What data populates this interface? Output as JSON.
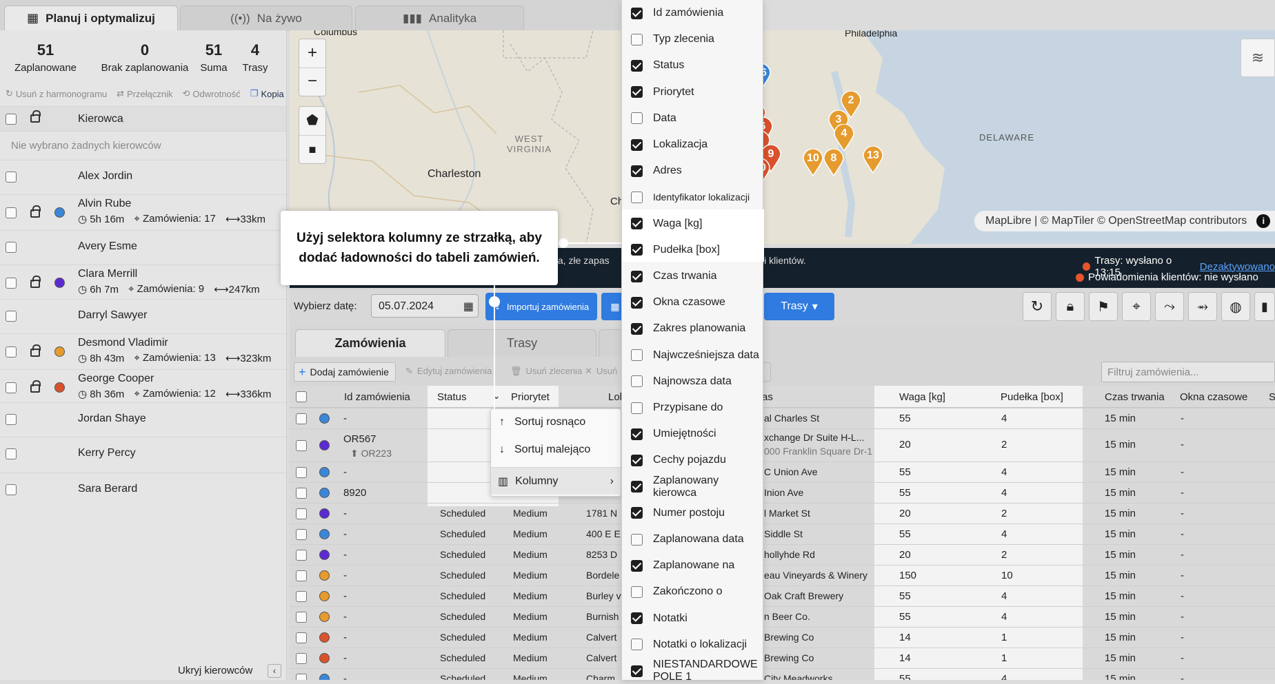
{
  "tabs": [
    {
      "label": "Planuj i optymalizuj",
      "icon": "calendar-icon"
    },
    {
      "label": "Na żywo",
      "icon": "broadcast-icon"
    },
    {
      "label": "Analityka",
      "icon": "bar-chart-icon"
    }
  ],
  "stats": [
    {
      "value": "51",
      "label": "Zaplanowane"
    },
    {
      "value": "0",
      "label": "Brak zaplanowania"
    },
    {
      "value": "51",
      "label": "Suma"
    },
    {
      "value": "4",
      "label": "Trasy"
    }
  ],
  "actions": {
    "remove": "Usuń z harmonogramu",
    "switch": "Przełącznik",
    "reverse": "Odwrotność",
    "copy": "Kopia"
  },
  "drivers_header": "Kierowca",
  "no_drivers": "Nie wybrano żadnych kierowców",
  "drivers": [
    {
      "name": "Alex Jordin"
    },
    {
      "name": "Alvin Rube",
      "color": "#3a86d8",
      "time": "5h 16m",
      "orders": "Zamówienia: 17",
      "dist": "33km"
    },
    {
      "name": "Avery Esme"
    },
    {
      "name": "Clara Merrill",
      "color": "#5b2bd1",
      "time": "6h 7m",
      "orders": "Zamówienia: 9",
      "dist": "247km"
    },
    {
      "name": "Darryl Sawyer"
    },
    {
      "name": "Desmond Vladimir",
      "color": "#e69b2e",
      "time": "8h 43m",
      "orders": "Zamówienia: 13",
      "dist": "323km"
    },
    {
      "name": "George Cooper",
      "color": "#d9522c",
      "time": "8h 36m",
      "orders": "Zamówienia: 12",
      "dist": "336km"
    },
    {
      "name": "Jordan Shaye"
    },
    {
      "name": "Kerry Percy"
    },
    {
      "name": "Sara Berard"
    }
  ],
  "hide_drivers": "Ukryj kierowców",
  "map": {
    "labels": [
      "Columbus",
      "Philadelphia",
      "WEST\nVIRGINIA",
      "Charleston",
      "DELAWARE",
      "Ch"
    ],
    "attribution": "MapLibre | © MapTiler © OpenStreetMap contributors",
    "pins": [
      "16",
      "2",
      "4",
      "3",
      "6",
      "7",
      "9",
      "10",
      "4",
      "10",
      "8",
      "13"
    ]
  },
  "banner": {
    "mid": "dla, złe zapas",
    "right_mid": "ji klientów.",
    "routes": "Trasy: wysłano o 13:15",
    "deactivate": "Dezaktywowano",
    "notif": "Powiadomienia klientów: nie wysłano"
  },
  "toolbar": {
    "date_label": "Wybierz datę:",
    "date": "05.07.2024",
    "import": "Importuj zamówienia",
    "routes": "Trasy"
  },
  "order_tabs": [
    "Zamówienia",
    "Trasy"
  ],
  "table_actions": {
    "add": "Dodaj zamówienie",
    "edit": "Edytuj zamówienia",
    "del": "Usuń zlecenia",
    "cancel": "Usuń"
  },
  "filter_placeholder": "Filtruj zamówienia...",
  "columns": {
    "id": "Id zamówienia",
    "status": "Status",
    "priority": "Priorytet",
    "location": "Lokaliza",
    "address": "as",
    "weight": "Waga [kg]",
    "boxes": "Pudełka [box]",
    "duration": "Czas trwania",
    "windows": "Okna czasowe",
    "extra": "S"
  },
  "rows": [
    {
      "color": "#3a86d8",
      "id": "-",
      "status": "",
      "priority": "",
      "loc": "",
      "addr": "al Charles St",
      "w": "55",
      "b": "4",
      "d": "15 min",
      "win": "-"
    },
    {
      "color": "#5b2bd1",
      "id": "OR567",
      "sub": "OR223",
      "status": "",
      "priority": "",
      "loc": "",
      "addr": "xchange Dr Suite H-L...",
      "addr2": "000 Franklin Square Dr-1...",
      "w": "20",
      "b": "2",
      "d": "15 min",
      "win": "-"
    },
    {
      "color": "#3a86d8",
      "id": "-",
      "status": "",
      "priority": "",
      "loc": "",
      "addr": "C Union Ave",
      "w": "55",
      "b": "4",
      "d": "15 min",
      "win": "-"
    },
    {
      "color": "#3a86d8",
      "id": "8920",
      "status": "",
      "priority": "",
      "loc": "",
      "addr": "Inion Ave",
      "w": "55",
      "b": "4",
      "d": "15 min",
      "win": "-"
    },
    {
      "color": "#5b2bd1",
      "id": "-",
      "status": "Scheduled",
      "priority": "Medium",
      "loc": "1781 N",
      "addr": "l Market St",
      "w": "20",
      "b": "2",
      "d": "15 min",
      "win": "-"
    },
    {
      "color": "#3a86d8",
      "id": "-",
      "status": "Scheduled",
      "priority": "Medium",
      "loc": "400 E E",
      "addr": "Siddle St",
      "w": "55",
      "b": "4",
      "d": "15 min",
      "win": "-"
    },
    {
      "color": "#5b2bd1",
      "id": "-",
      "status": "Scheduled",
      "priority": "Medium",
      "loc": "8253 D",
      "addr": "hollyhde Rd",
      "w": "20",
      "b": "2",
      "d": "15 min",
      "win": "-"
    },
    {
      "color": "#e69b2e",
      "id": "-",
      "status": "Scheduled",
      "priority": "Medium",
      "loc": "Bordele",
      "addr": "eau Vineyards & Winery",
      "w": "150",
      "b": "10",
      "d": "15 min",
      "win": "-"
    },
    {
      "color": "#e69b2e",
      "id": "-",
      "status": "Scheduled",
      "priority": "Medium",
      "loc": "Burley v",
      "addr": "Oak Craft Brewery",
      "w": "55",
      "b": "4",
      "d": "15 min",
      "win": "-"
    },
    {
      "color": "#e69b2e",
      "id": "-",
      "status": "Scheduled",
      "priority": "Medium",
      "loc": "Burnish",
      "addr": "n Beer Co.",
      "w": "55",
      "b": "4",
      "d": "15 min",
      "win": "-"
    },
    {
      "color": "#d9522c",
      "id": "-",
      "status": "Scheduled",
      "priority": "Medium",
      "loc": "Calvert",
      "addr": "Brewing Co",
      "w": "14",
      "b": "1",
      "d": "15 min",
      "win": "-"
    },
    {
      "color": "#d9522c",
      "id": "-",
      "status": "Scheduled",
      "priority": "Medium",
      "loc": "Calvert",
      "addr": "Brewing Co",
      "w": "14",
      "b": "1",
      "d": "15 min",
      "win": "-"
    },
    {
      "color": "#3a86d8",
      "id": "-",
      "status": "Scheduled",
      "priority": "Medium",
      "loc": "Charm",
      "addr": "City Meadworks",
      "w": "55",
      "b": "4",
      "d": "15 min",
      "win": "-"
    }
  ],
  "context_menu": {
    "asc": "Sortuj rosnąco",
    "desc": "Sortuj malejąco",
    "cols": "Kolumny"
  },
  "tooltip": "Użyj selektora kolumny ze strzałką, aby dodać ładowności do tabeli zamówień.",
  "column_options": [
    {
      "label": "Id zamówienia",
      "on": true
    },
    {
      "label": "Typ zlecenia",
      "on": false
    },
    {
      "label": "Status",
      "on": true
    },
    {
      "label": "Priorytet",
      "on": true
    },
    {
      "label": "Data",
      "on": false
    },
    {
      "label": "Lokalizacja",
      "on": true
    },
    {
      "label": "Adres",
      "on": true
    },
    {
      "label": "Identyfikator lokalizacji",
      "on": false
    },
    {
      "label": "Waga [kg]",
      "on": true
    },
    {
      "label": "Pudełka [box]",
      "on": true
    },
    {
      "label": "Czas trwania",
      "on": true
    },
    {
      "label": "Okna czasowe",
      "on": true
    },
    {
      "label": "Zakres planowania",
      "on": true
    },
    {
      "label": "Najwcześniejsza data",
      "on": false
    },
    {
      "label": "Najnowsza data",
      "on": false
    },
    {
      "label": "Przypisane do",
      "on": false
    },
    {
      "label": "Umiejętności",
      "on": true
    },
    {
      "label": "Cechy pojazdu",
      "on": true
    },
    {
      "label": "Zaplanowany kierowca",
      "on": true
    },
    {
      "label": "Numer postoju",
      "on": true
    },
    {
      "label": "Zaplanowana data",
      "on": false
    },
    {
      "label": "Zaplanowane na",
      "on": true
    },
    {
      "label": "Zakończono o",
      "on": false
    },
    {
      "label": "Notatki",
      "on": true
    },
    {
      "label": "Notatki o lokalizacji",
      "on": false
    },
    {
      "label": "NIESTANDARDOWE POLE 1",
      "on": true
    }
  ]
}
